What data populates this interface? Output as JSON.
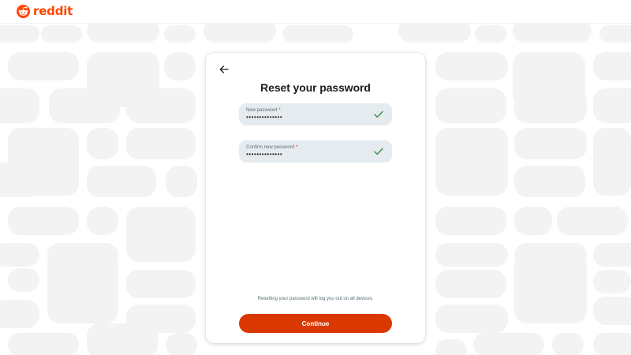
{
  "header": {
    "logo_text": "reddit",
    "logo_icon": "reddit-snoo-icon",
    "brand_color": "#ff4500"
  },
  "modal": {
    "back_icon": "arrow-left-icon",
    "title": "Reset your password",
    "fields": [
      {
        "label": "New password",
        "required_marker": "*",
        "value": "••••••••••••••",
        "status_icon": "check-icon",
        "status_color": "#2e8540"
      },
      {
        "label": "Confirm new password",
        "required_marker": "*",
        "value": "••••••••••••••",
        "status_icon": "check-icon",
        "status_color": "#2e8540"
      }
    ],
    "note": "Resetting your password will log you out on all devices.",
    "continue_label": "Continue",
    "continue_color": "#d93900"
  }
}
